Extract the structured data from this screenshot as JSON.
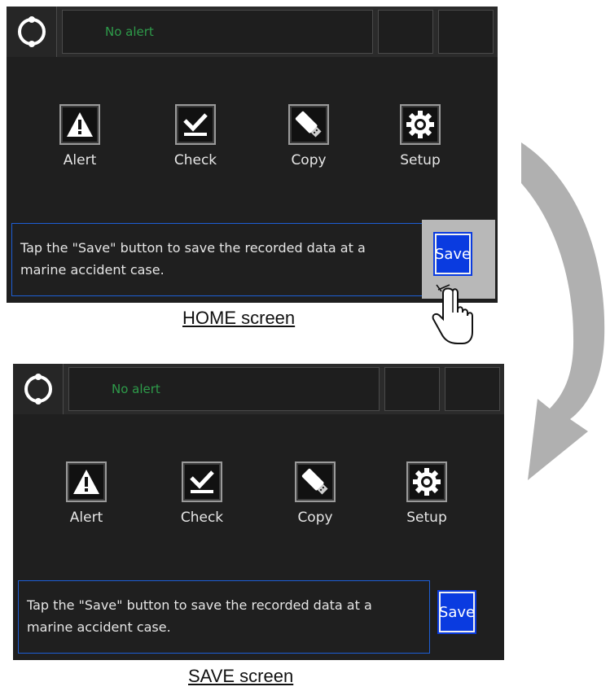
{
  "screens": [
    {
      "id": "home",
      "caption": "HOME screen",
      "alert_text": "No alert",
      "icons": [
        {
          "label": "Alert",
          "icon": "warning-icon"
        },
        {
          "label": "Check",
          "icon": "checkmark-icon"
        },
        {
          "label": "Copy",
          "icon": "usb-drive-icon"
        },
        {
          "label": "Setup",
          "icon": "gear-icon"
        }
      ],
      "message": "Tap the \"Save\" button to save the recorded data at a marine accident case.",
      "save_label": "Save",
      "save_highlighted": true
    },
    {
      "id": "save",
      "caption": "SAVE screen",
      "alert_text": "No alert",
      "icons": [
        {
          "label": "Alert",
          "icon": "warning-icon"
        },
        {
          "label": "Check",
          "icon": "checkmark-icon"
        },
        {
          "label": "Copy",
          "icon": "usb-drive-icon"
        },
        {
          "label": "Setup",
          "icon": "gear-icon"
        }
      ],
      "message": "Tap the \"Save\" button to save the recorded data at a marine accident case.",
      "save_label": "Save",
      "save_highlighted": false
    }
  ],
  "colors": {
    "panel_bg": "#1f1f1f",
    "alert_text": "#2e9b4a",
    "save_button": "#0a3be0",
    "message_border": "#1d5fd6",
    "highlight": "#b8b8b8",
    "arrow": "#b0b0b0"
  },
  "decorations": {
    "transition_arrow": "curved-arrow-icon",
    "pointer": "tapping-hand-icon"
  }
}
